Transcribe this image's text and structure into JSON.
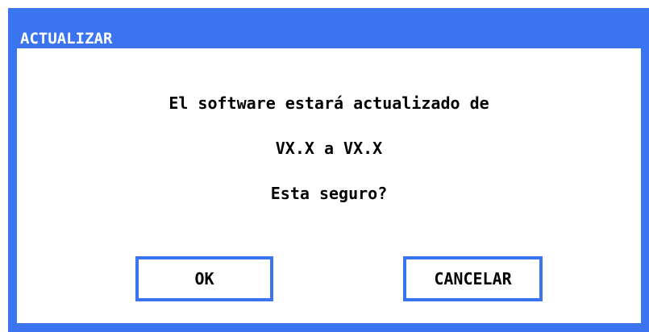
{
  "dialog": {
    "title": "ACTUALIZAR",
    "message_line_1": "El software estará actualizado de",
    "message_line_2": "VX.X a VX.X",
    "message_line_3": "Esta seguro?",
    "ok_label": "OK",
    "cancel_label": "CANCELAR"
  },
  "colors": {
    "frame": "#3a74ee",
    "background": "#ffffff",
    "text": "#000000",
    "title_text": "#ffffff"
  }
}
